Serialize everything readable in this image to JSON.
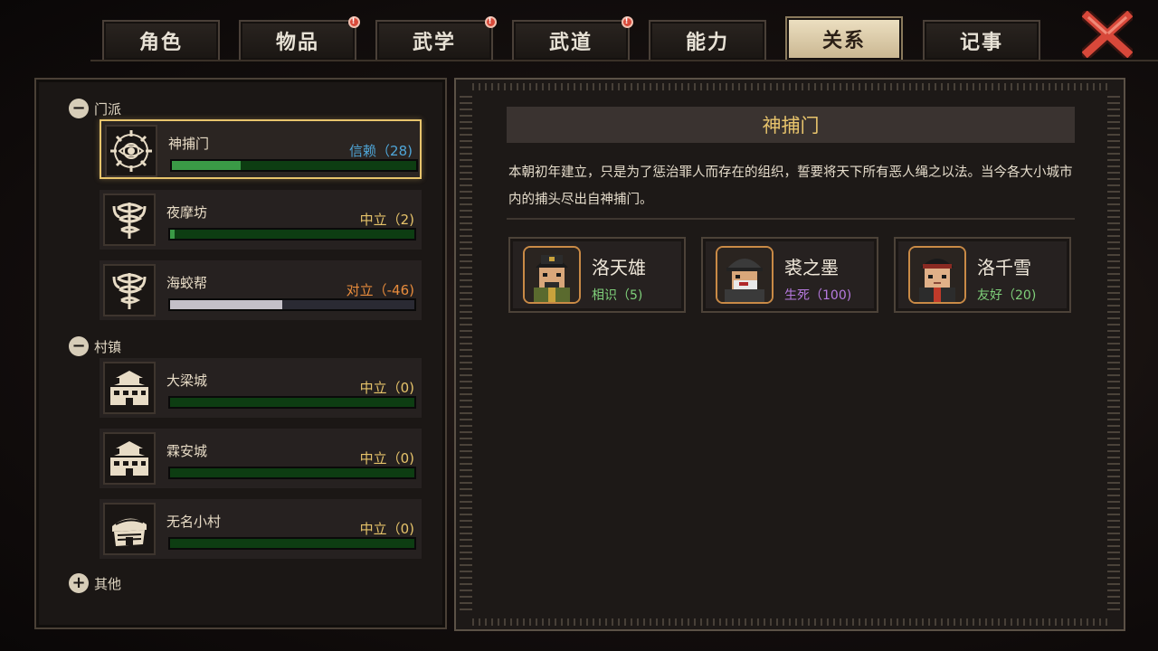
{
  "tabs": [
    {
      "label": "角色",
      "active": false,
      "alert": false
    },
    {
      "label": "物品",
      "active": false,
      "alert": true
    },
    {
      "label": "武学",
      "active": false,
      "alert": true
    },
    {
      "label": "武道",
      "active": false,
      "alert": true
    },
    {
      "label": "能力",
      "active": false,
      "alert": false
    },
    {
      "label": "关系",
      "active": true,
      "alert": false
    },
    {
      "label": "记事",
      "active": false,
      "alert": false
    }
  ],
  "alert_mark": "!",
  "groups": {
    "sect": {
      "label": "门派",
      "toggle": "−"
    },
    "town": {
      "label": "村镇",
      "toggle": "−"
    },
    "other": {
      "label": "其他",
      "toggle": "+"
    }
  },
  "factions": [
    {
      "name": "神捕门",
      "status": "信赖（28)",
      "status_color": "#4fa6d8",
      "progress": 0.28,
      "bar_color": "#3a9a46",
      "icon": "eye-emblem-icon",
      "selected": true
    },
    {
      "name": "夜摩坊",
      "status": "中立（2)",
      "status_color": "#e6c36a",
      "progress": 0.02,
      "bar_color": "#3a9a46",
      "icon": "serpent-staff-emblem-icon",
      "selected": false
    },
    {
      "name": "海蛟帮",
      "status": "对立（-46)",
      "status_color": "#e88c3c",
      "progress": 0.46,
      "bar_color": "#c4c0c8",
      "bar_bg": "#2a2a33",
      "icon": "serpent-staff-emblem-icon",
      "selected": false
    },
    {
      "name": "大梁城",
      "status": "中立（0)",
      "status_color": "#e6c36a",
      "progress": 0.0,
      "bar_color": "#3a9a46",
      "icon": "city-gate-icon",
      "selected": false
    },
    {
      "name": "霖安城",
      "status": "中立（0)",
      "status_color": "#e6c36a",
      "progress": 0.0,
      "bar_color": "#3a9a46",
      "icon": "city-gate-icon",
      "selected": false
    },
    {
      "name": "无名小村",
      "status": "中立（0)",
      "status_color": "#e6c36a",
      "progress": 0.0,
      "bar_color": "#3a9a46",
      "icon": "village-hut-icon",
      "selected": false
    }
  ],
  "detail": {
    "title": "神捕门",
    "description": "本朝初年建立，只是为了惩治罪人而存在的组织，誓要将天下所有恶人绳之以法。当今各大小城市内的捕头尽出自神捕门。"
  },
  "members": [
    {
      "name": "洛天雄",
      "relation": "相识（5)",
      "relation_color": "#7fd07a"
    },
    {
      "name": "裘之墨",
      "relation": "生死（100)",
      "relation_color": "#b77ae0"
    },
    {
      "name": "洛千雪",
      "relation": "友好（20)",
      "relation_color": "#7fd07a"
    }
  ],
  "colors": {
    "accent_gold": "#e7c46c",
    "tab_active_bg": "#ede0c2",
    "close_red": "#d8483a"
  }
}
